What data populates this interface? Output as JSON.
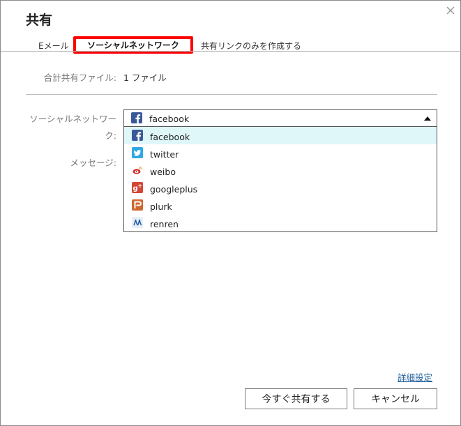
{
  "dialog": {
    "title": "共有"
  },
  "tabs": [
    {
      "label": "Eメール"
    },
    {
      "label": "ソーシャルネットワーク",
      "active": true
    },
    {
      "label": "共有リンクのみを作成する"
    }
  ],
  "shared_files": {
    "label": "合計共有ファイル:",
    "value": "1 ファイル"
  },
  "social": {
    "label": "ソーシャルネットワーク:",
    "selected": "facebook",
    "options": [
      {
        "label": "facebook",
        "icon": "facebook-icon",
        "color": "#3b5998",
        "highlighted": true
      },
      {
        "label": "twitter",
        "icon": "twitter-icon",
        "color": "#2fa9e1"
      },
      {
        "label": "weibo",
        "icon": "weibo-icon",
        "color": "#d52b2a"
      },
      {
        "label": "googleplus",
        "icon": "googleplus-icon",
        "color": "#d34836"
      },
      {
        "label": "plurk",
        "icon": "plurk-icon",
        "color": "#cf682f"
      },
      {
        "label": "renren",
        "icon": "renren-icon",
        "color": "#1d5aa5"
      }
    ]
  },
  "message": {
    "label": "メッセージ:"
  },
  "links": {
    "advanced": "詳細設定"
  },
  "buttons": {
    "share_now": "今すぐ共有する",
    "cancel": "キャンセル"
  },
  "colors": {
    "active_tab_outline": "#ff0000",
    "option_highlight": "#dff7f9",
    "link": "#1f5f9a"
  }
}
